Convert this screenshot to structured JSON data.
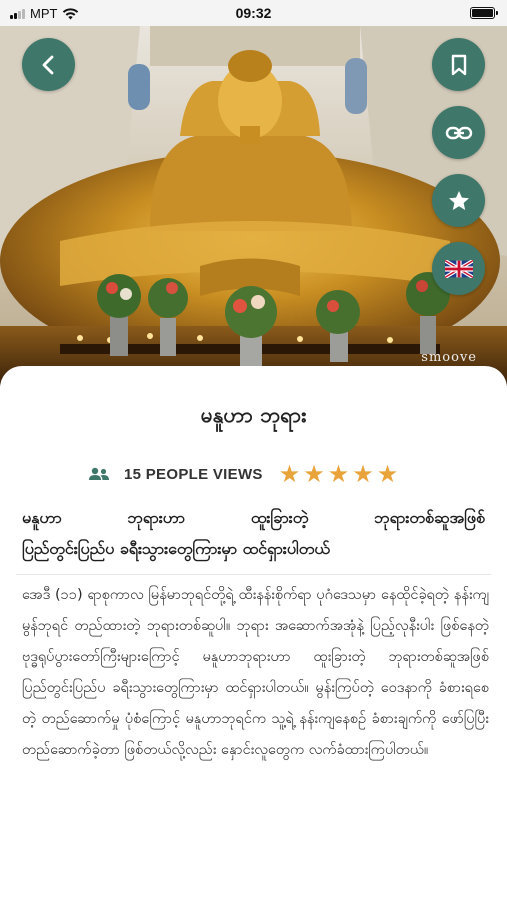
{
  "status_bar": {
    "carrier": "MPT",
    "time": "09:32"
  },
  "hero": {
    "watermark": "smoove",
    "buttons": {
      "back": "back-icon",
      "bookmark": "bookmark-icon",
      "link": "link-icon",
      "favorite": "star-icon",
      "language": "uk-flag-icon"
    }
  },
  "place": {
    "title": "မနူဟာ ဘုရား",
    "views": "15 PEOPLE VIEWS",
    "rating": 5,
    "subtitle_line1": "မနူဟာ ဘုရားဟာ ထူးခြားတဲ့ ဘုရားတစ်ဆူအဖြစ်",
    "subtitle_line2": "ပြည်တွင်းပြည်ပ ခရီးသွားတွေကြားမှာ ထင်ရှားပါတယ်",
    "description": "အေဒီ (၁၁) ရာစုကာလ မြန်မာဘုရင်တို့ရဲ့ ထီးနန်းစိုက်ရာ ပုဂံဒေသမှာ နေထိုင်ခဲ့ရတဲ့ နန်းကျ မွန်ဘုရင် တည်ထားတဲ့ ဘုရားတစ်ဆူပါ။ ဘုရား အဆောက်အအုံနဲ့ ပြည့်လုနီးပါး ဖြစ်နေတဲ့ ဗုဒ္ဓရုပ်ပွားတော်ကြီးများကြောင့် မနူဟာဘုရားဟာ ထူးခြားတဲ့ ဘုရားတစ်ဆူအဖြစ် ပြည်တွင်းပြည်ပ ခရီးသွားတွေကြားမှာ ထင်ရှားပါတယ်။ မွန်းကြပ်တဲ့ ဝေဒနာကို ခံစားရစေတဲ့ တည်ဆောက်မှု ပုံစံကြောင့် မနူဟာဘုရင်က သူ့ရဲ့ နန်းကျနေစဉ် ခံစားချက်ကို ဖော်ပြပြီး တည်ဆောက်ခဲ့တာ ဖြစ်တယ်လို့လည်း နှောင်းလူတွေက လက်ခံထားကြပါတယ်။"
  },
  "colors": {
    "accent_button": "#3f786a",
    "star": "#e8a33a"
  }
}
